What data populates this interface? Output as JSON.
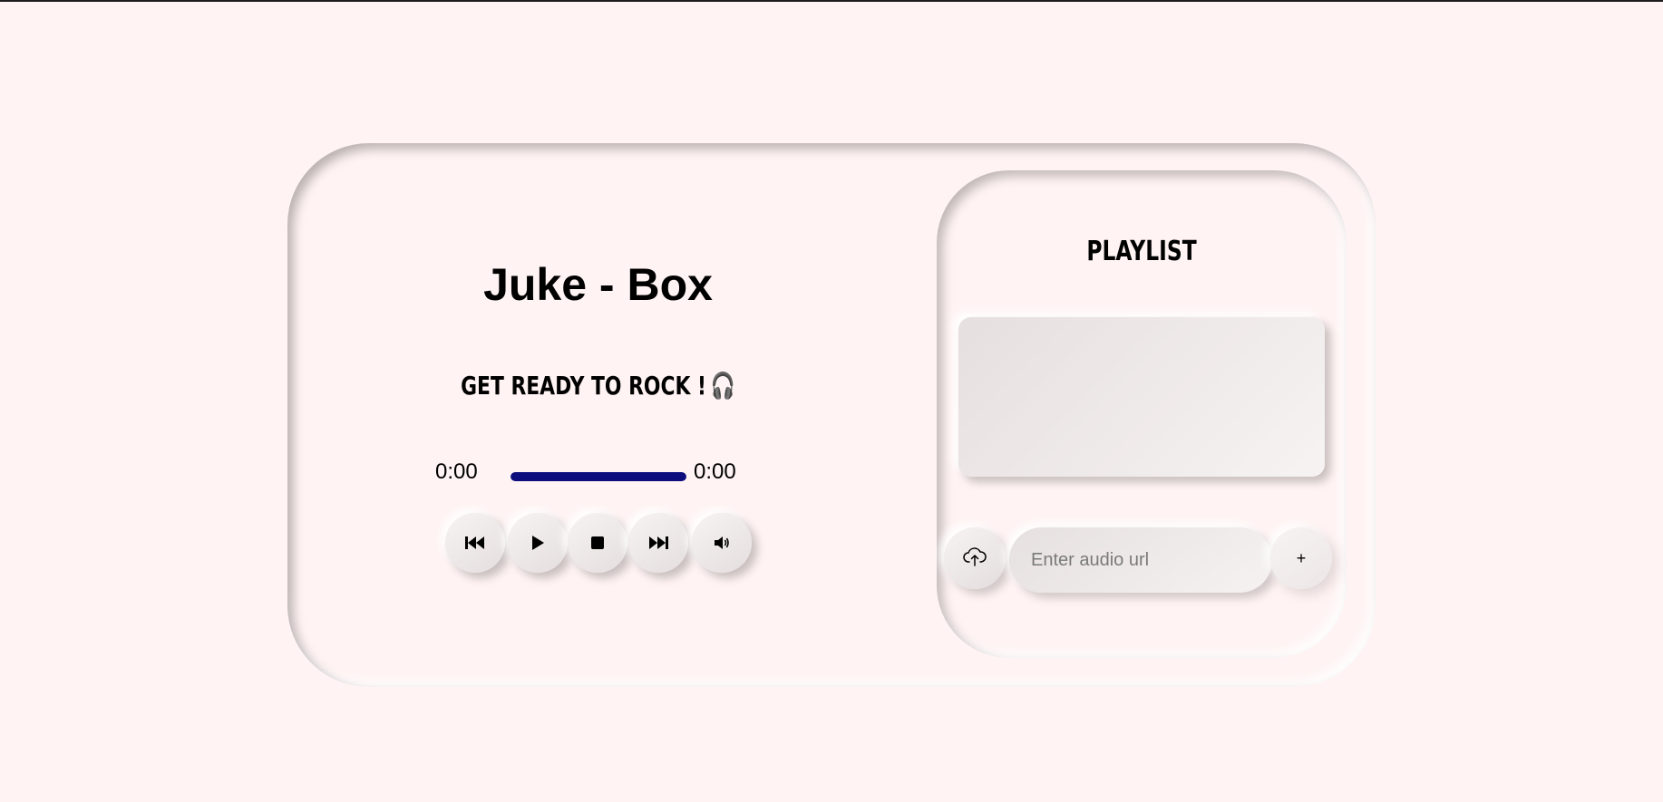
{
  "player": {
    "title": "Juke - Box",
    "tagline": "GET READY TO ROCK !",
    "tagline_emoji": "🎧",
    "current_time": "0:00",
    "duration": "0:00",
    "progress_fraction": 1.0,
    "progress_color": "#0d0d7d",
    "controls": [
      {
        "name": "previous-button",
        "icon": "skip-back-icon"
      },
      {
        "name": "play-button",
        "icon": "play-icon"
      },
      {
        "name": "stop-button",
        "icon": "stop-icon"
      },
      {
        "name": "next-button",
        "icon": "skip-forward-icon"
      },
      {
        "name": "volume-button",
        "icon": "volume-icon"
      }
    ]
  },
  "playlist": {
    "title": "PLAYLIST",
    "items": [],
    "url_input": {
      "placeholder": "Enter audio url",
      "value": ""
    },
    "upload_icon": "cloud-upload-icon",
    "add_label": "+"
  },
  "colors": {
    "background": "#fff3f3",
    "accent": "#0d0d7d"
  }
}
